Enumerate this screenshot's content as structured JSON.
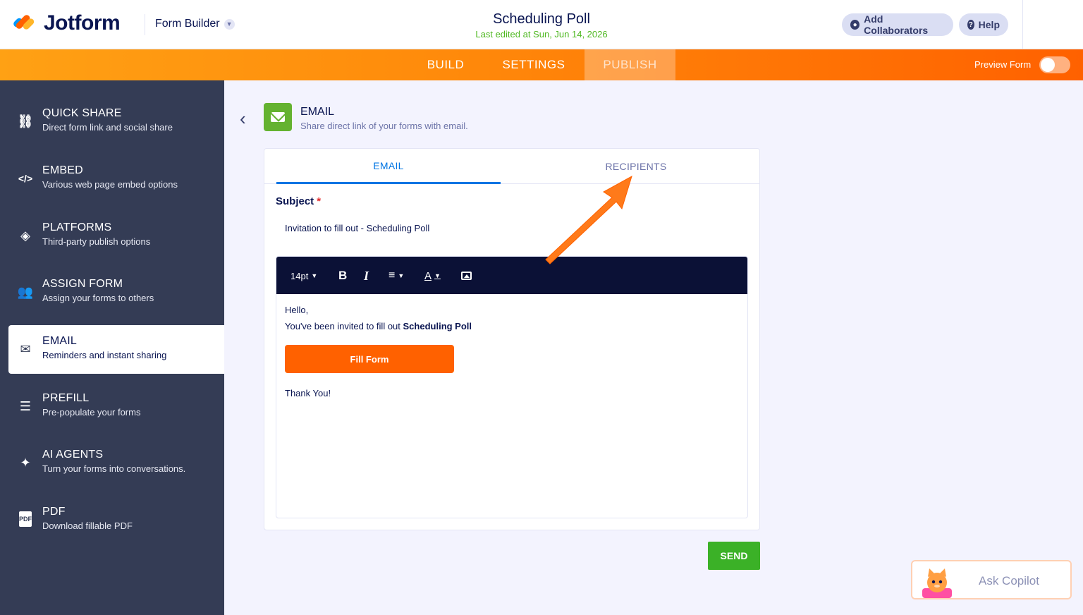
{
  "header": {
    "logo_text": "Jotform",
    "form_builder_label": "Form Builder",
    "form_title": "Scheduling Poll",
    "last_edited": "Last edited at Sun, Jun 14, 2026",
    "collaborators_label": "Add Collaborators",
    "help_label": "Help"
  },
  "nav": {
    "tabs": [
      "BUILD",
      "SETTINGS",
      "PUBLISH"
    ],
    "active_tab": "PUBLISH",
    "preview_label": "Preview Form",
    "preview_enabled": false
  },
  "sidebar": {
    "items": [
      {
        "title": "QUICK SHARE",
        "desc": "Direct form link and social share",
        "icon": "link-icon"
      },
      {
        "title": "EMBED",
        "desc": "Various web page embed options",
        "icon": "code-icon"
      },
      {
        "title": "PLATFORMS",
        "desc": "Third-party publish options",
        "icon": "layers-icon"
      },
      {
        "title": "ASSIGN FORM",
        "desc": "Assign your forms to others",
        "icon": "users-icon"
      },
      {
        "title": "EMAIL",
        "desc": "Reminders and instant sharing",
        "icon": "envelope-icon",
        "active": true
      },
      {
        "title": "PREFILL",
        "desc": "Pre-populate your forms",
        "icon": "prefill-icon"
      },
      {
        "title": "AI AGENTS",
        "desc": "Turn your forms into conversations.",
        "icon": "sparkle-icon"
      },
      {
        "title": "PDF",
        "desc": "Download fillable PDF",
        "icon": "pdf-icon"
      }
    ]
  },
  "main": {
    "title": "EMAIL",
    "subtitle": "Share direct link of your forms with email.",
    "tabs": [
      "EMAIL",
      "RECIPIENTS"
    ],
    "active_tab": "EMAIL",
    "subject_label": "Subject",
    "required_mark": "*",
    "subject_value": "Invitation to fill out - Scheduling Poll",
    "toolbar": {
      "font_size": "14pt",
      "bold": "B",
      "italic": "I",
      "align": "≡",
      "text_color": "A"
    },
    "body": {
      "greeting": "Hello,",
      "invited_prefix": "You've been invited to fill out ",
      "form_name": "Scheduling Poll",
      "button_label": "Fill Form",
      "closing": "Thank You!"
    },
    "send_label": "SEND"
  },
  "copilot": {
    "label": "Ask Copilot"
  },
  "colors": {
    "accent_orange": "#ff6100",
    "active_tab_blue": "#0075e3",
    "send_green": "#3bb127",
    "sidebar_bg": "#343c55",
    "toolbar_bg": "#0b1136",
    "last_edited_green": "#4fb821"
  }
}
